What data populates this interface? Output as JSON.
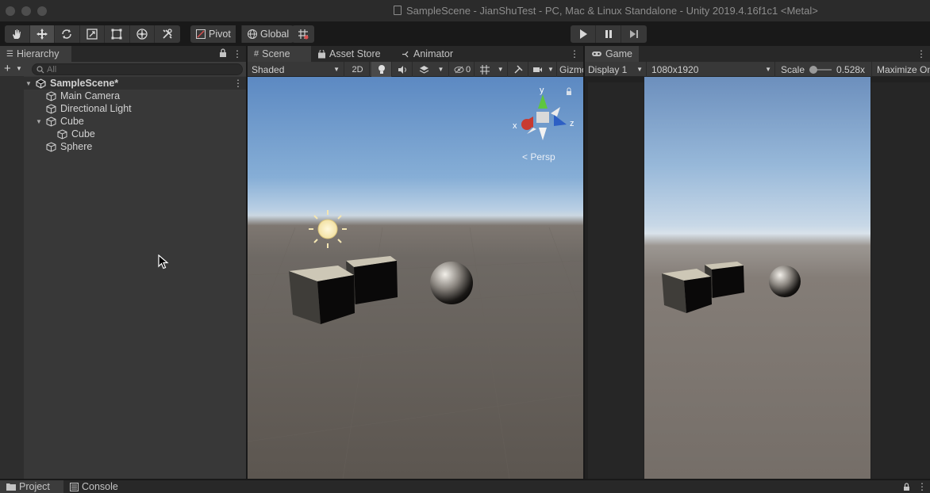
{
  "window": {
    "title": "SampleScene - JianShuTest - PC, Mac & Linux Standalone - Unity 2019.4.16f1c1 <Metal>"
  },
  "toolbar": {
    "transform_tools": [
      "hand-tool-icon",
      "move-tool-icon",
      "rotate-tool-icon",
      "scale-tool-icon",
      "rect-tool-icon",
      "transform-tool-icon",
      "custom-tool-icon"
    ],
    "pivot_label": "Pivot",
    "global_label": "Global",
    "playback": [
      "play-icon",
      "pause-icon",
      "step-icon"
    ]
  },
  "hierarchy": {
    "tab_label": "Hierarchy",
    "search_placeholder": "All",
    "items": [
      {
        "label": "SampleScene*",
        "type": "scene"
      },
      {
        "label": "Main Camera",
        "type": "gameobject"
      },
      {
        "label": "Directional Light",
        "type": "gameobject"
      },
      {
        "label": "Cube",
        "type": "gameobject"
      },
      {
        "label": "Cube",
        "type": "gameobject"
      },
      {
        "label": "Sphere",
        "type": "gameobject"
      }
    ]
  },
  "scene_panel": {
    "tabs": [
      {
        "label": "Scene",
        "icon": "grid-icon"
      },
      {
        "label": "Asset Store",
        "icon": "bag-icon"
      },
      {
        "label": "Animator",
        "icon": "animator-icon"
      }
    ],
    "shading_mode": "Shaded",
    "mode_2d_label": "2D",
    "hidden_count": "0",
    "gizmos_label": "Gizmos",
    "gizmo_axes": {
      "x": "x",
      "y": "y",
      "z": "z"
    },
    "projection_label": "Persp"
  },
  "game_panel": {
    "tab_label": "Game",
    "display": "Display 1",
    "resolution": "1080x1920",
    "scale_label": "Scale",
    "scale_value": "0.528x",
    "maximize_label": "Maximize On Play"
  },
  "bottom": {
    "tabs": [
      {
        "label": "Project",
        "icon": "folder-icon"
      },
      {
        "label": "Console",
        "icon": "console-icon"
      }
    ]
  },
  "colors": {
    "panel_bg": "#383838",
    "tab_bg": "#282828",
    "active_tab": "#3c3c3c",
    "sky_top": "#5c89c2",
    "ground": "#5c5650"
  }
}
